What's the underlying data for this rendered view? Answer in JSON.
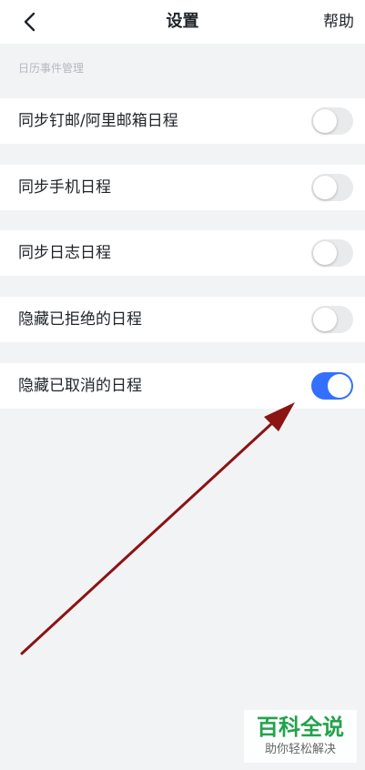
{
  "header": {
    "title": "设置",
    "help_label": "帮助",
    "back_icon": "chevron-left-icon"
  },
  "section": {
    "title": "日历事件管理"
  },
  "settings": [
    {
      "label": "同步钉邮/阿里邮箱日程",
      "enabled": false
    },
    {
      "label": "同步手机日程",
      "enabled": false
    },
    {
      "label": "同步日志日程",
      "enabled": false
    },
    {
      "label": "隐藏已拒绝的日程",
      "enabled": false
    },
    {
      "label": "隐藏已取消的日程",
      "enabled": true
    }
  ],
  "colors": {
    "toggle_on": "#3370ff",
    "toggle_off": "#e9eaec",
    "arrow": "#8b1414",
    "watermark": "#22a34a"
  },
  "watermark": {
    "title": "百科全说",
    "subtitle": "助你轻松解决"
  }
}
